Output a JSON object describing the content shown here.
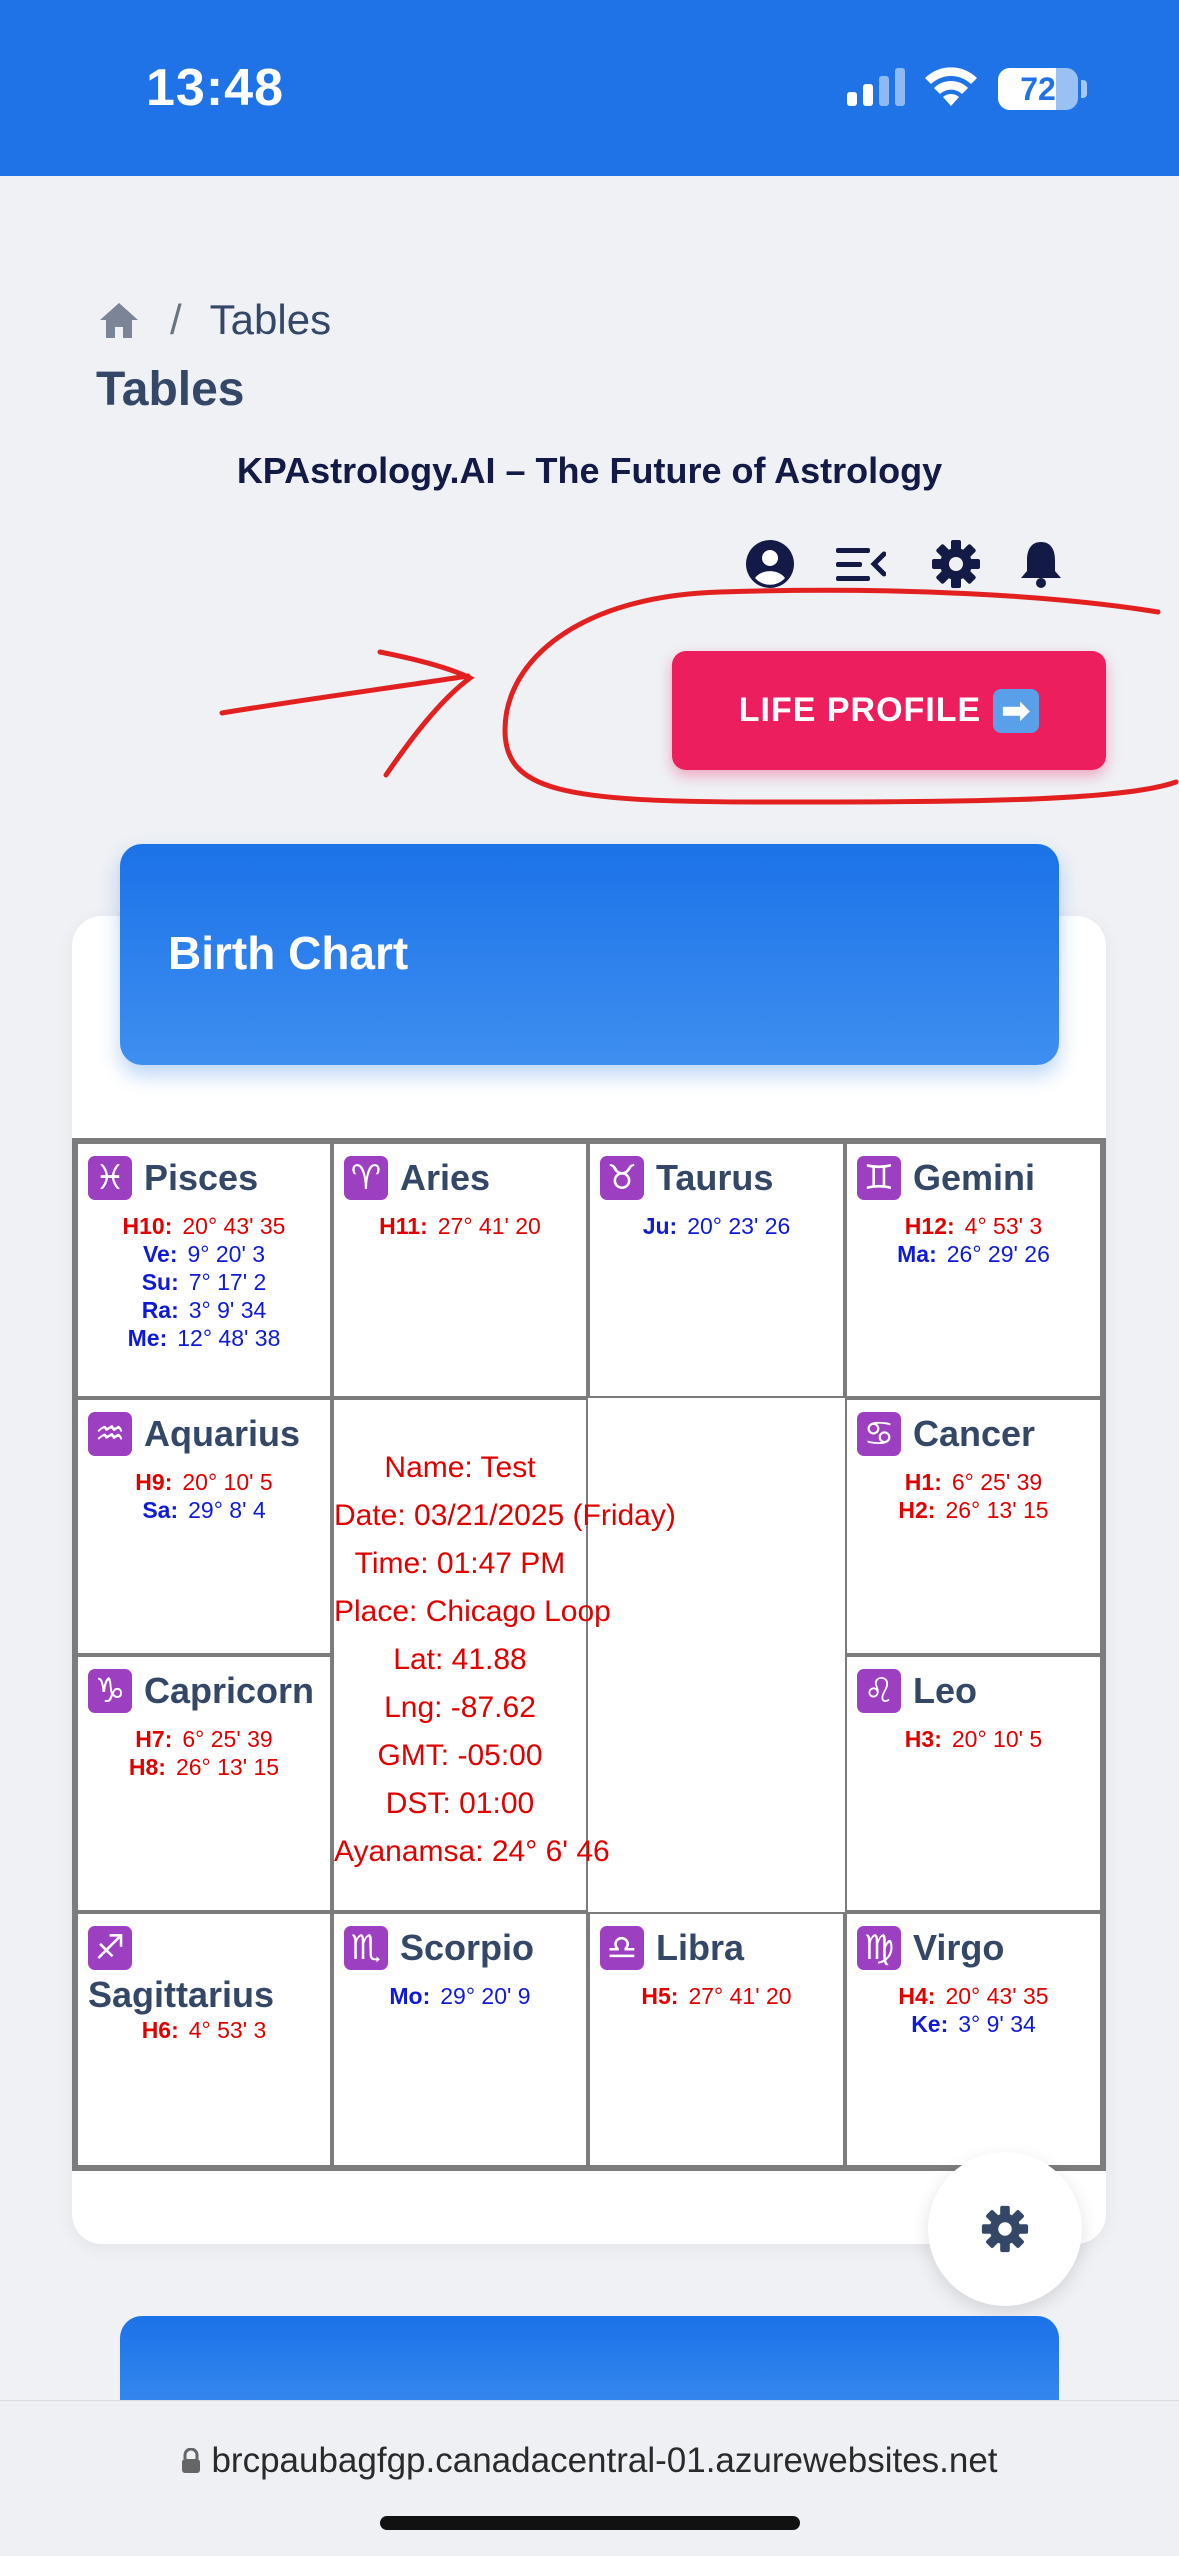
{
  "status_bar": {
    "time": "13:48",
    "battery": "72",
    "battery_level": 0.72
  },
  "breadcrumb": {
    "separator": "/",
    "current": "Tables"
  },
  "page": {
    "title": "Tables",
    "brand": "KPAstrology.AI – The Future of Astrology"
  },
  "toolbar": {
    "icons": [
      "user-circle-icon",
      "menu-collapse-icon",
      "gear-icon",
      "bell-icon"
    ]
  },
  "cta": {
    "label": "LIFE PROFILE",
    "emoji": "➡"
  },
  "birth_chart": {
    "title": "Birth Chart",
    "houses": {
      "pisces": {
        "glyph": "♓",
        "name": "Pisces",
        "p": [
          [
            "H10:",
            "20° 43' 35"
          ],
          [
            "Ve:",
            "9° 20' 3"
          ],
          [
            "Su:",
            "7° 17' 2"
          ],
          [
            "Ra:",
            "3° 9' 34"
          ],
          [
            "Me:",
            "12° 48' 38"
          ]
        ]
      },
      "aries": {
        "glyph": "♈",
        "name": "Aries",
        "p": [
          [
            "H11:",
            "27° 41' 20"
          ]
        ]
      },
      "taurus": {
        "glyph": "♉",
        "name": "Taurus",
        "p": [
          [
            "Ju:",
            "20° 23' 26"
          ]
        ]
      },
      "gemini": {
        "glyph": "♊",
        "name": "Gemini",
        "p": [
          [
            "H12:",
            "4° 53' 3"
          ],
          [
            "Ma:",
            "26° 29' 26"
          ]
        ]
      },
      "aquarius": {
        "glyph": "♒",
        "name": "Aquarius",
        "p": [
          [
            "H9:",
            "20° 10' 5"
          ],
          [
            "Sa:",
            "29° 8' 4"
          ]
        ]
      },
      "cancer": {
        "glyph": "♋",
        "name": "Cancer",
        "p": [
          [
            "H1:",
            "6° 25' 39"
          ],
          [
            "H2:",
            "26° 13' 15"
          ]
        ]
      },
      "capricorn": {
        "glyph": "♑",
        "name": "Capricorn",
        "p": [
          [
            "H7:",
            "6° 25' 39"
          ],
          [
            "H8:",
            "26° 13' 15"
          ]
        ]
      },
      "leo": {
        "glyph": "♌",
        "name": "Leo",
        "p": [
          [
            "H3:",
            "20° 10' 5"
          ]
        ]
      },
      "sagittarius": {
        "glyph": "♐",
        "name": "Sagittarius",
        "p": [
          [
            "H6:",
            "4° 53' 3"
          ]
        ]
      },
      "scorpio": {
        "glyph": "♏",
        "name": "Scorpio",
        "p": [
          [
            "Mo:",
            "29° 20' 9"
          ]
        ]
      },
      "libra": {
        "glyph": "♎",
        "name": "Libra",
        "p": [
          [
            "H5:",
            "27° 41' 20"
          ]
        ]
      },
      "virgo": {
        "glyph": "♍",
        "name": "Virgo",
        "p": [
          [
            "H4:",
            "20° 43' 35"
          ],
          [
            "Ke:",
            "3° 9' 34"
          ]
        ]
      }
    },
    "details": [
      "Name: Test",
      "Date: 03/21/2025 (Friday)",
      "Time: 01:47 PM",
      "Place: Chicago Loop",
      "Lat: 41.88",
      "Lng: -87.62",
      "GMT: -05:00",
      "DST: 01:00",
      "Ayanamsa: 24° 6' 46"
    ]
  },
  "address_bar": {
    "url": "brcpaubagfgp.canadacentral-01.azurewebsites.net"
  },
  "colors": {
    "brand_blue": "#1f73e6",
    "cta_pink": "#ec1e5d",
    "house_red": "#e00000",
    "planet_blue": "#0f1ad9",
    "glyph_purple": "#9c3fc0"
  }
}
